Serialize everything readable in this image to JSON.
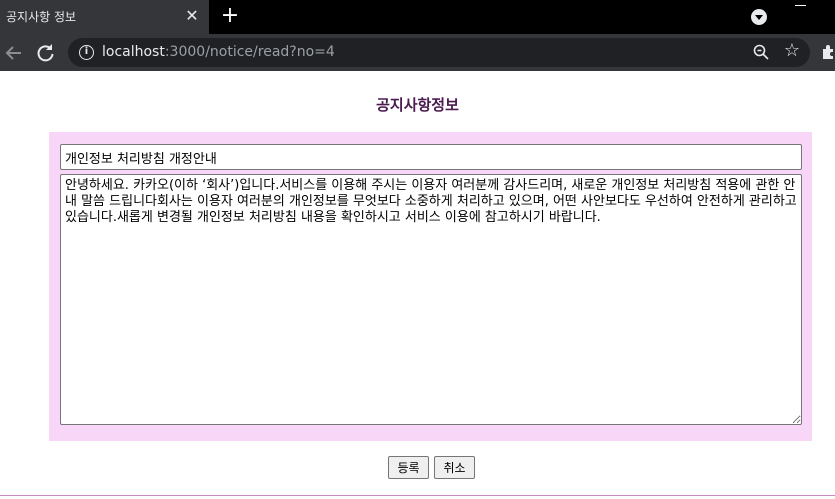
{
  "browser": {
    "tab_title": "공지사항 정보",
    "close_symbol": "✕",
    "new_tab_symbol": "+",
    "url_host": "localhost",
    "url_rest": ":3000/notice/read?no=4",
    "icons": [
      "back-arrow-icon",
      "reload-icon",
      "info-icon",
      "zoom-icon",
      "bookmark-star-icon",
      "extensions-icon",
      "profile-menu-icon",
      "minimize-icon"
    ]
  },
  "page": {
    "heading": "공지사항정보",
    "title_value": "개인정보 처리방침 개정안내",
    "content_value": "안녕하세요. 카카오(이하 ‘회사’)입니다.서비스를 이용해 주시는 이용자 여러분께 감사드리며, 새로운 개인정보 처리방침 적용에 관한 안내 말씀 드립니다회사는 이용자 여러분의 개인정보를 무엇보다 소중하게 처리하고 있으며, 어떤 사안보다도 우선하여 안전하게 관리하고 있습니다.새롭게 변경될 개인정보 처리방침 내용을 확인하시고 서비스 이용에 참고하시기 바랍니다.",
    "register_label": "등록",
    "cancel_label": "취소"
  },
  "colors": {
    "panel_background": "#f8d6f7",
    "heading_color": "#4b1a4f",
    "browser_toolbar": "#35363a"
  }
}
